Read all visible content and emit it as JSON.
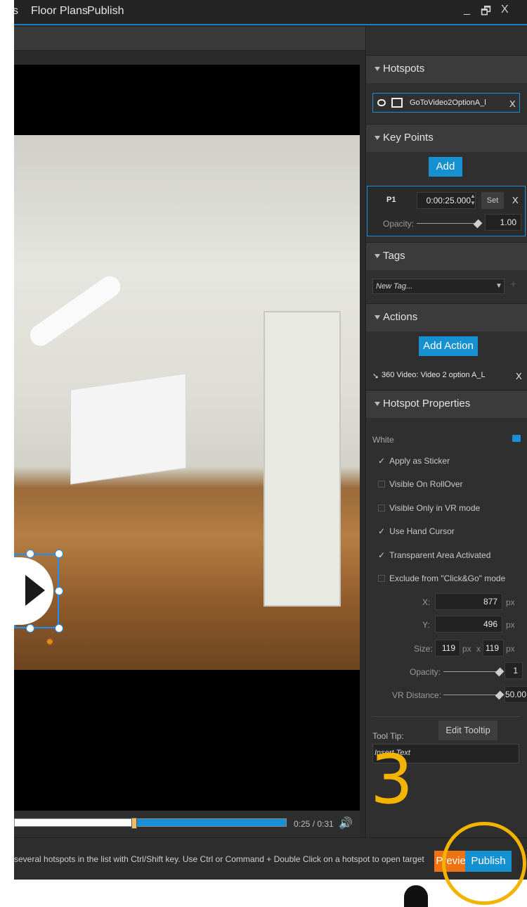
{
  "menubar": {
    "items": [
      "s",
      "Floor Plans",
      "Publish"
    ],
    "minimize": "_",
    "restore": "🗗",
    "close": "X"
  },
  "player": {
    "time": "0:25 / 0:31",
    "progress": 0.44
  },
  "status": {
    "text": "several hotspots in the list with Ctrl/Shift key. Use Ctrl or Command + Double Click on a hotspot to open target"
  },
  "buttons": {
    "preview": "Preview",
    "publish": "Publish"
  },
  "sidebar": {
    "hotspots": {
      "title": "Hotspots",
      "item": "GoToVideo2OptionA_l",
      "remove": "X"
    },
    "keypoints": {
      "title": "Key Points",
      "add": "Add",
      "point": {
        "name": "P1",
        "time": "0:00:25.000",
        "set": "Set",
        "remove": "X",
        "opacity_label": "Opacity:",
        "opacity": "1.00"
      }
    },
    "tags": {
      "title": "Tags",
      "placeholder": "New Tag...",
      "add": "+"
    },
    "actions": {
      "title": "Actions",
      "add": "Add Action",
      "item": "360 Video: Video 2 option A_L",
      "remove": "X"
    },
    "properties": {
      "title": "Hotspot Properties",
      "style": "White",
      "options": [
        {
          "label": "Apply as Sticker",
          "checked": true
        },
        {
          "label": "Visible On RollOver",
          "checked": false
        },
        {
          "label": "Visible Only in VR mode",
          "checked": false
        },
        {
          "label": "Use Hand Cursor",
          "checked": true
        },
        {
          "label": "Transparent Area Activated",
          "checked": true
        },
        {
          "label": "Exclude from \"Click&Go\" mode",
          "checked": false
        }
      ],
      "x_label": "X:",
      "x": "877",
      "y_label": "Y:",
      "y": "496",
      "size_label": "Size:",
      "width": "119",
      "height": "119",
      "times": "x",
      "unit": "px",
      "opacity_label": "Opacity:",
      "opacity": "1",
      "vr_label": "VR Distance:",
      "vr": "50.00",
      "tooltip_label": "Tool Tip:",
      "edit_tooltip": "Edit Tooltip",
      "tooltip_placeholder": "Insert Text"
    }
  },
  "annotation": {
    "step": "3"
  },
  "colors": {
    "accent": "#1590d1",
    "highlight": "#f2b400",
    "preview": "#f07312"
  }
}
